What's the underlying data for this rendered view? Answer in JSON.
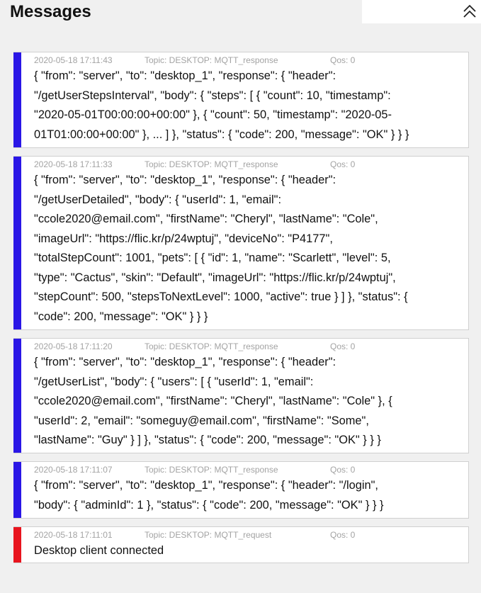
{
  "header": {
    "title": "Messages",
    "collapse_icon": "double-chevron-up-icon"
  },
  "colors": {
    "response_bar": "#2a16e6",
    "request_bar": "#e8141e"
  },
  "messages": [
    {
      "timestamp": "2020-05-18 17:11:43",
      "topic": "Topic: DESKTOP: MQTT_response",
      "qos": "Qos: 0",
      "kind": "response",
      "body": "{ \"from\": \"server\", \"to\": \"desktop_1\", \"response\": { \"header\":\n\"/getUserStepsInterval\", \"body\": { \"steps\": [ { \"count\": 10, \"timestamp\":\n\"2020-05-01T00:00:00+00:00\" }, { \"count\": 50, \"timestamp\": \"2020-05-\n01T01:00:00+00:00\" }, ... ] }, \"status\": { \"code\": 200, \"message\": \"OK\" } } }"
    },
    {
      "timestamp": "2020-05-18 17:11:33",
      "topic": "Topic: DESKTOP: MQTT_response",
      "qos": "Qos: 0",
      "kind": "response",
      "body": "{ \"from\": \"server\", \"to\": \"desktop_1\", \"response\": { \"header\":\n\"/getUserDetailed\", \"body\": { \"userId\": 1, \"email\":\n\"ccole2020@email.com\", \"firstName\": \"Cheryl\", \"lastName\": \"Cole\",\n\"imageUrl\": \"https://flic.kr/p/24wptuj\", \"deviceNo\": \"P4177\",\n\"totalStepCount\": 1001, \"pets\": [ { \"id\": 1, \"name\": \"Scarlett\", \"level\": 5,\n\"type\": \"Cactus\", \"skin\": \"Default\", \"imageUrl\": \"https://flic.kr/p/24wptuj\",\n\"stepCount\": 500, \"stepsToNextLevel\": 1000, \"active\": true } ] }, \"status\": {\n\"code\": 200, \"message\": \"OK\" } } }"
    },
    {
      "timestamp": "2020-05-18 17:11:20",
      "topic": "Topic: DESKTOP: MQTT_response",
      "qos": "Qos: 0",
      "kind": "response",
      "body": "{ \"from\": \"server\", \"to\": \"desktop_1\", \"response\": { \"header\":\n\"/getUserList\", \"body\": { \"users\": [ { \"userId\": 1, \"email\":\n\"ccole2020@email.com\", \"firstName\": \"Cheryl\", \"lastName\": \"Cole\" }, {\n\"userId\": 2, \"email\": \"someguy@email.com\", \"firstName\": \"Some\",\n\"lastName\": \"Guy\" } ] }, \"status\": { \"code\": 200, \"message\": \"OK\" } } }"
    },
    {
      "timestamp": "2020-05-18 17:11:07",
      "topic": "Topic: DESKTOP: MQTT_response",
      "qos": "Qos: 0",
      "kind": "response",
      "body": "{ \"from\": \"server\", \"to\": \"desktop_1\", \"response\": { \"header\": \"/login\",\n\"body\": { \"adminId\": 1 }, \"status\": { \"code\": 200, \"message\": \"OK\" } } }"
    },
    {
      "timestamp": "2020-05-18 17:11:01",
      "topic": "Topic: DESKTOP: MQTT_request",
      "qos": "Qos: 0",
      "kind": "request",
      "body": "Desktop client connected"
    }
  ]
}
